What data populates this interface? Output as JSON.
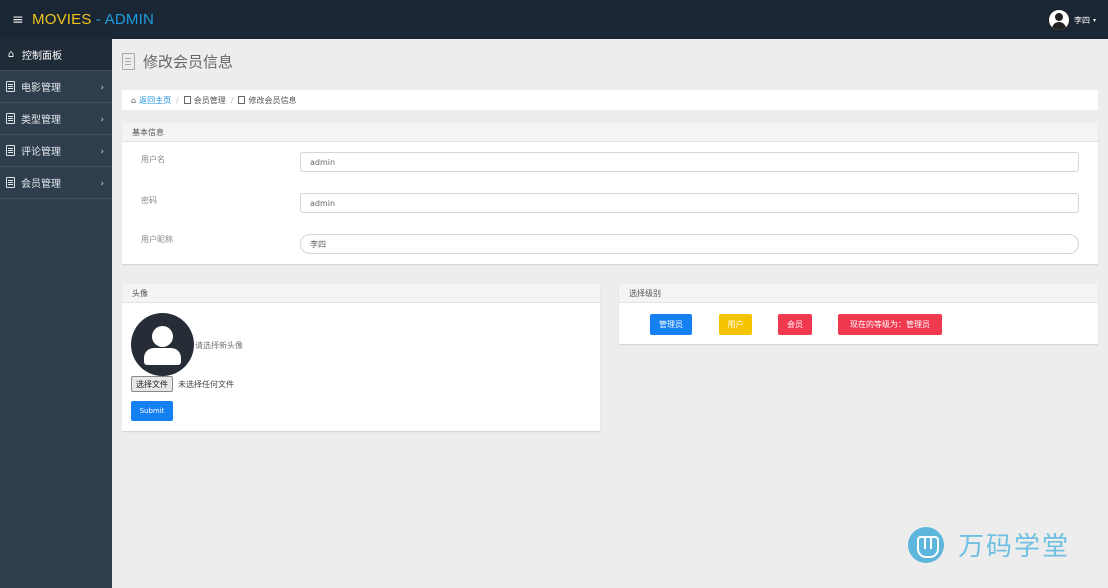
{
  "header": {
    "menu_icon": "≡",
    "brand_primary": "MOVIES",
    "brand_sep": " - ",
    "brand_secondary": "ADMIN",
    "user_name": "李四",
    "user_caret": "▾"
  },
  "sidebar": {
    "items": [
      {
        "label": "控制面板",
        "icon": "home-icon"
      },
      {
        "label": "电影管理",
        "icon": "document-icon"
      },
      {
        "label": "类型管理",
        "icon": "document-icon"
      },
      {
        "label": "评论管理",
        "icon": "document-icon"
      },
      {
        "label": "会员管理",
        "icon": "document-icon"
      }
    ],
    "chevron": "›"
  },
  "page": {
    "title": "修改会员信息"
  },
  "breadcrumb": {
    "home": "返回主页",
    "sep": "/",
    "item1": "会员管理",
    "item2": "修改会员信息"
  },
  "basic_panel": {
    "heading": "基本信息",
    "fields": [
      {
        "label": "用户名",
        "value": "admin"
      },
      {
        "label": "密码",
        "value": "admin"
      },
      {
        "label": "用户昵称",
        "value": "李四"
      }
    ]
  },
  "avatar_panel": {
    "heading": "头像",
    "hint": "请选择新头像",
    "file_button": "选择文件",
    "file_status": "未选择任何文件",
    "submit": "Submit"
  },
  "level_panel": {
    "heading": "选择级别",
    "buttons": [
      {
        "label": "管理员",
        "color": "#1580f2"
      },
      {
        "label": "用户",
        "color": "#f5c400"
      },
      {
        "label": "会员",
        "color": "#f0384f"
      }
    ],
    "current": "现在的等级为：管理员",
    "current_color": "#f0384f"
  },
  "watermark": {
    "text": "万码学堂",
    "color": "#6fc0e2"
  }
}
